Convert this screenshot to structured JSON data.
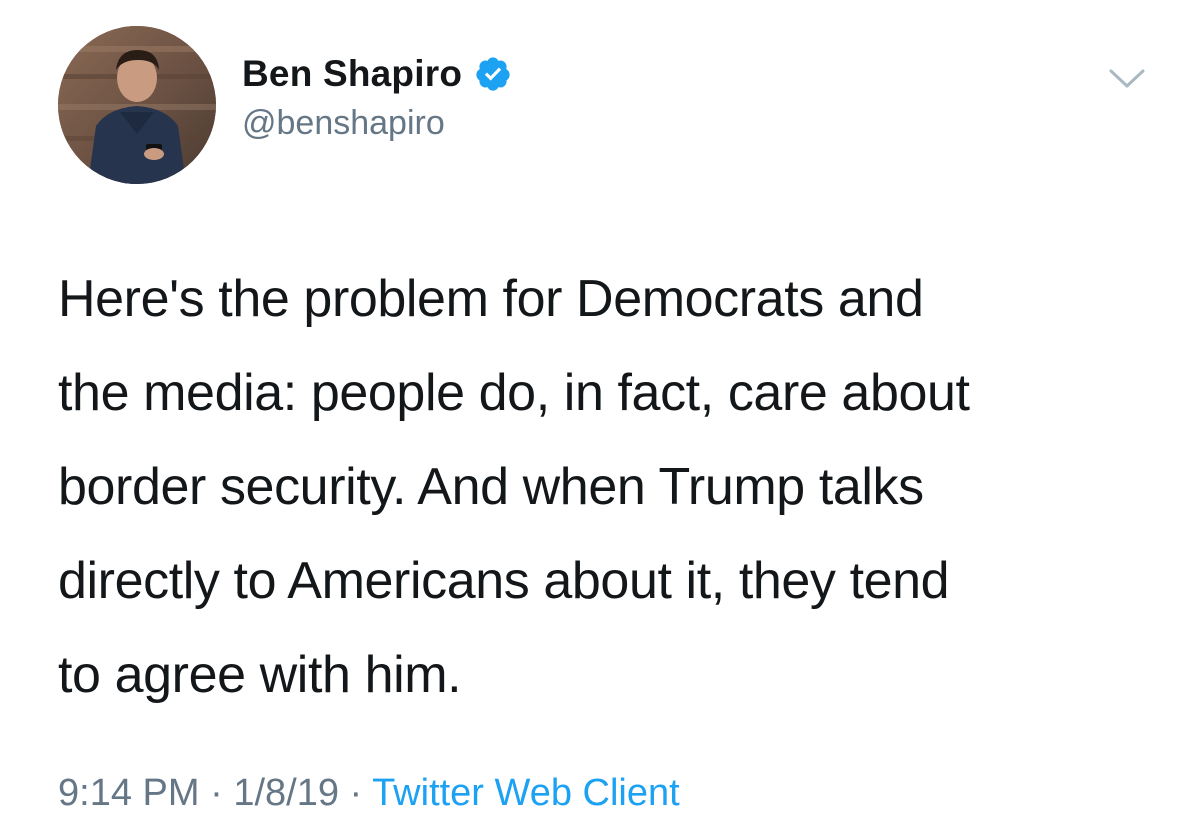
{
  "tweet": {
    "author": {
      "display_name": "Ben Shapiro",
      "handle": "@benshapiro",
      "verified": true,
      "avatar_icon": "profile-photo"
    },
    "text": "Here's the problem for Democrats and the media: people do, in fact, care about border security. And when Trump talks directly to Americans about it, they tend to agree with him.",
    "text_lines": [
      "Here's the problem for Democrats and",
      "the media: people do, in fact, care about",
      "border security. And when Trump talks",
      "directly to Americans about it, they tend",
      "to agree with him."
    ],
    "time": "9:14 PM",
    "date": "1/8/19",
    "separator": "·",
    "source": "Twitter Web Client"
  },
  "colors": {
    "verified_badge": "#1da1f2",
    "link": "#1da1f2",
    "secondary_text": "#657786",
    "primary_text": "#14171a"
  }
}
